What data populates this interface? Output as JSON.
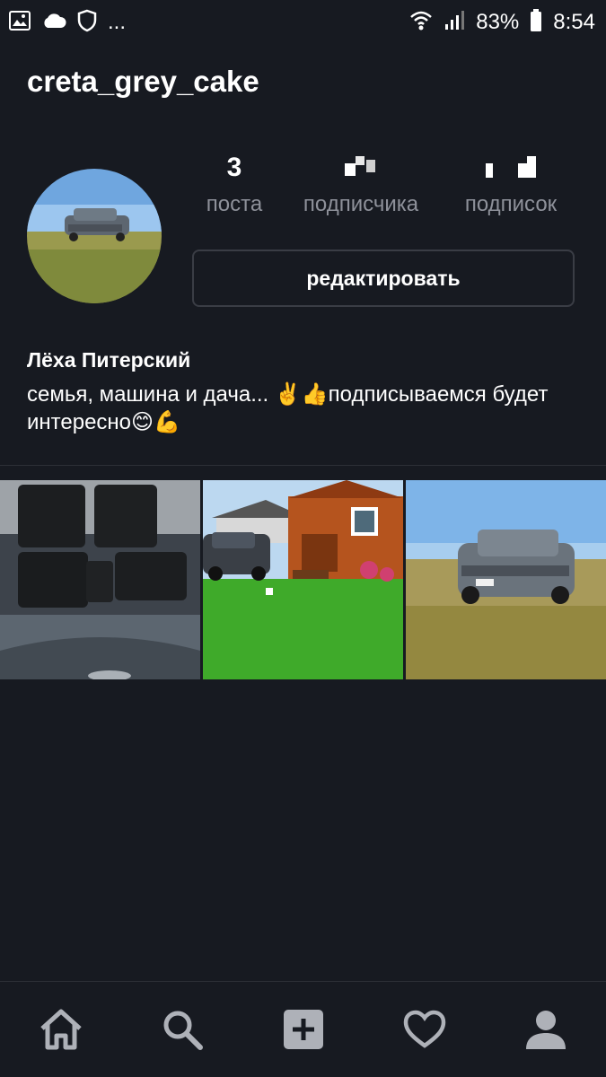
{
  "status_bar": {
    "overflow": "...",
    "battery": "83%",
    "time": "8:54",
    "icons": [
      "image-icon",
      "cloud-icon",
      "shield-icon",
      "wifi-icon",
      "signal-icon",
      "battery-icon"
    ]
  },
  "profile": {
    "username": "creta_grey_cake",
    "avatar": "avatar-photo-car-in-field",
    "stats": [
      {
        "value": "3",
        "label": "поста"
      },
      {
        "value": "",
        "label": "подписчика"
      },
      {
        "value": "",
        "label": "подписок"
      }
    ],
    "edit_button": "редактировать",
    "full_name": "Лёха Питерский",
    "bio": "семья, машина и дача... ✌️👍подписываемся будет интересно😊💪"
  },
  "posts": [
    {
      "name": "post-car-mats"
    },
    {
      "name": "post-house-lawn"
    },
    {
      "name": "post-car-field"
    }
  ],
  "nav": {
    "items": [
      "home-icon",
      "search-icon",
      "add-post-icon",
      "heart-icon",
      "profile-icon"
    ]
  },
  "colors": {
    "background": "#171a21",
    "secondary_text": "#8e919a",
    "border": "#3a3d45"
  }
}
